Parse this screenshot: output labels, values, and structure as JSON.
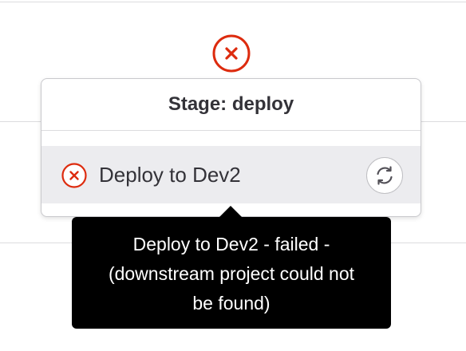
{
  "stage_dropdown": {
    "title": "Stage: deploy",
    "job": {
      "name": "Deploy to Dev2",
      "status_icon": "status-failed-icon",
      "action_icon": "retry-icon"
    }
  },
  "tooltip": {
    "line1": "Deploy to Dev2 - failed -",
    "line2": "(downstream project could not",
    "line3": "be found)"
  },
  "colors": {
    "failed": "#dd2b0e",
    "tooltip_bg": "#000000",
    "row_highlight": "#ececef"
  }
}
